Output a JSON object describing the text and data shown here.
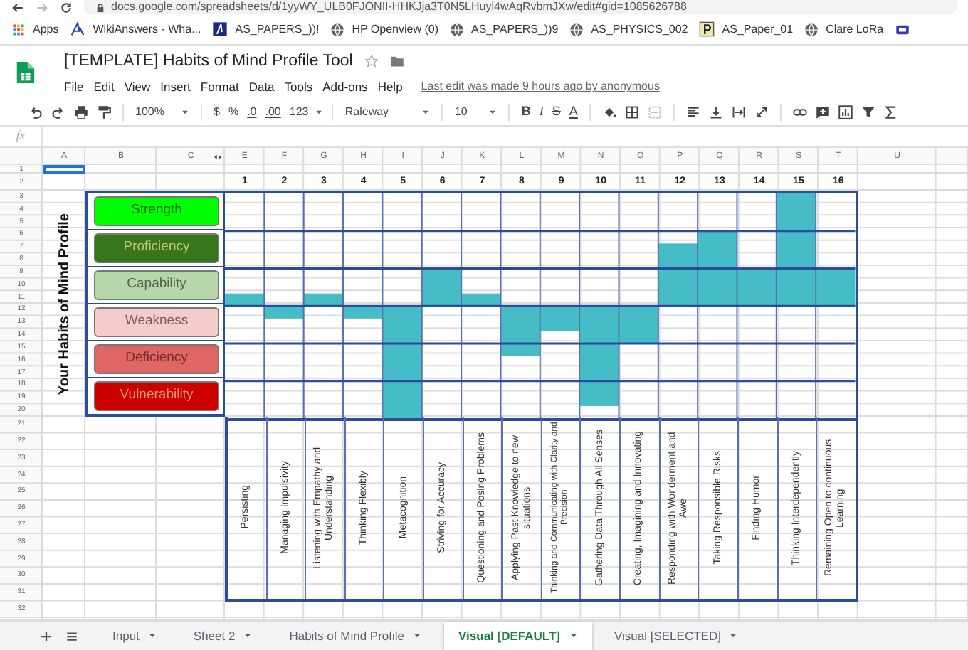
{
  "browser": {
    "url": "docs.google.com/spreadsheets/d/1yyWY_ULB0FJONII-HHKJja3T0N5LHuyl4wAqRvbmJXw/edit#gid=1085626788"
  },
  "bookmarks": [
    {
      "label": "Apps",
      "kind": "apps"
    },
    {
      "label": "WikiAnswers - Wha...",
      "kind": "site"
    },
    {
      "label": "AS_PAPERS_))!",
      "kind": "page"
    },
    {
      "label": "HP Openview (0)",
      "kind": "globe"
    },
    {
      "label": "AS_PAPERS_))9",
      "kind": "globe"
    },
    {
      "label": "AS_PHYSICS_002",
      "kind": "globe"
    },
    {
      "label": "AS_Paper_01",
      "kind": "letter"
    },
    {
      "label": "Clare LoRa",
      "kind": "globe"
    }
  ],
  "document": {
    "title": "[TEMPLATE] Habits of Mind Profile Tool",
    "last_edit": "Last edit was made 9 hours ago by anonymous"
  },
  "menu": [
    "File",
    "Edit",
    "View",
    "Insert",
    "Format",
    "Data",
    "Tools",
    "Add-ons",
    "Help"
  ],
  "toolbar": {
    "zoom": "100%",
    "currency": "$",
    "percent": "%",
    "decrease_decimals": ".0",
    "increase_decimals": ".00",
    "number_format": "123",
    "font": "Raleway",
    "font_size": "10",
    "bold": "B",
    "italic": "I",
    "strikethrough": "S",
    "text_color": "A"
  },
  "formula_bar": {
    "label": "fx"
  },
  "column_headers": [
    "A",
    "B",
    "C",
    "E",
    "F",
    "G",
    "H",
    "I",
    "J",
    "K",
    "L",
    "M",
    "N",
    "O",
    "P",
    "Q",
    "R",
    "S",
    "T",
    "U"
  ],
  "row_numbers": [
    "1",
    "2",
    "3",
    "4",
    "5",
    "6",
    "7",
    "8",
    "9",
    "10",
    "11",
    "12",
    "13",
    "14",
    "15",
    "16",
    "17",
    "18",
    "19",
    "20",
    "21",
    "22",
    "23",
    "24",
    "25",
    "26",
    "27",
    "28",
    "29",
    "30",
    "31",
    "32"
  ],
  "sheet_title": "Your Habits of Mind Profile",
  "profile_levels": [
    {
      "label": "Strength",
      "color": "#00ff00"
    },
    {
      "label": "Proficiency",
      "color": "#38761d"
    },
    {
      "label": "Capability",
      "color": "#b6d7a8"
    },
    {
      "label": "Weakness",
      "color": "#f4cccc"
    },
    {
      "label": "Deficiency",
      "color": "#e06666"
    },
    {
      "label": "Vulnerability",
      "color": "#cc0000"
    }
  ],
  "column_numbers": [
    "1",
    "2",
    "3",
    "4",
    "5",
    "6",
    "7",
    "8",
    "9",
    "10",
    "11",
    "12",
    "13",
    "14",
    "15",
    "16"
  ],
  "habits": [
    "Persisting",
    "Managing Impulsivity",
    "Listening with Empathy and Understanding",
    "Thinking Flexibly",
    "Metacognition",
    "Striving for Accuracy",
    "Questioning and Posing Problems",
    "Applying Past Knowledge to new situations",
    "Thinking and Communicating with Clarity and Precision",
    "Gathering Data Through All Senses",
    "Creating, Imagining and Innovating",
    "Responding with Wonderment and Awe",
    "Taking Responsible Risks",
    "Finding Humor",
    "Thinking Interdependently",
    "Remaining Open to continuous Learning"
  ],
  "sheet_tabs": [
    {
      "label": "Input",
      "selected": false
    },
    {
      "label": "Sheet 2",
      "selected": false
    },
    {
      "label": "Habits of Mind Profile",
      "selected": false
    },
    {
      "label": "Visual [DEFAULT]",
      "selected": true
    },
    {
      "label": "Visual [SELECTED]",
      "selected": false
    }
  ]
}
